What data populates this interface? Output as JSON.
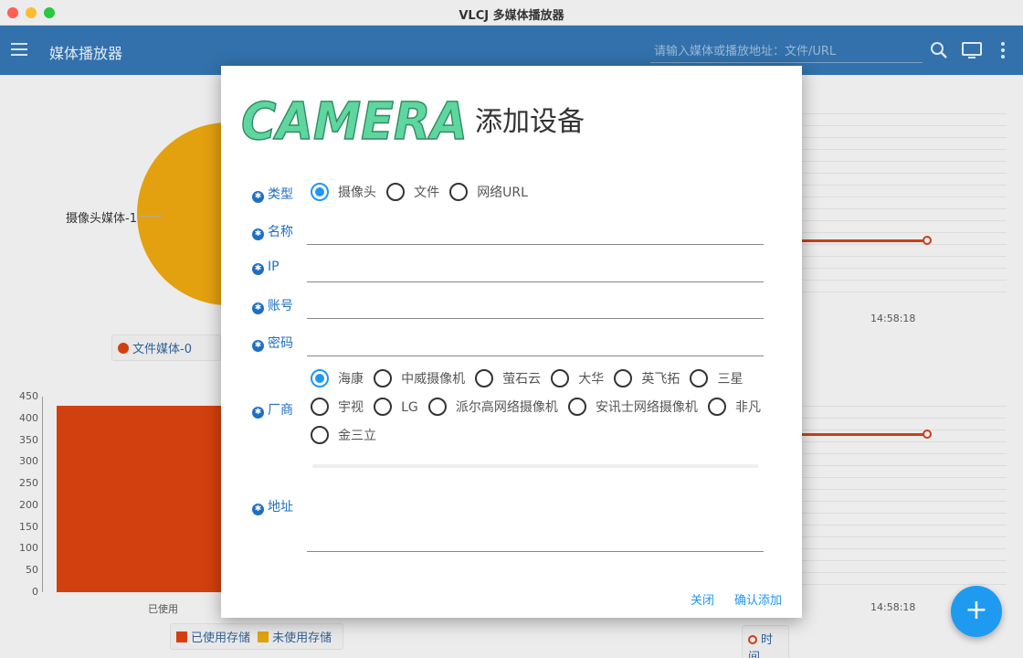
{
  "window": {
    "title": "VLCJ 多媒体播放器"
  },
  "header": {
    "title": "媒体播放器",
    "search_placeholder": "请输入媒体或播放地址：文件/URL",
    "icons": [
      "menu-icon",
      "search-icon",
      "tv-icon",
      "more-vert-icon"
    ]
  },
  "background": {
    "pie_label": "摄像头媒体-1",
    "pie_legend": [
      "文件媒体-0"
    ],
    "bar_yticks": [
      "450",
      "400",
      "350",
      "300",
      "250",
      "200",
      "150",
      "100",
      "50",
      "0"
    ],
    "bar_xlabel": "已使用",
    "bar_legend": [
      "已使用存储",
      "未使用存储"
    ],
    "line_xtick_1": "14:58:18",
    "line_xtick_2": "14:58:18",
    "line_legend": "时间",
    "colors": {
      "orange_red": "#d3400f",
      "amber": "#e3a10f",
      "line": "#c9401a"
    }
  },
  "dialog": {
    "logo_text": "CAMERA",
    "title": "添加设备",
    "fields": {
      "type": {
        "label": "类型",
        "options": [
          "摄像头",
          "文件",
          "网络URL"
        ],
        "selected": "摄像头"
      },
      "name": {
        "label": "名称",
        "value": ""
      },
      "ip": {
        "label": "IP",
        "value": ""
      },
      "account": {
        "label": "账号",
        "value": ""
      },
      "password": {
        "label": "密码",
        "value": ""
      },
      "vendor": {
        "label": "厂商",
        "row1": [
          "海康",
          "中威摄像机",
          "萤石云",
          "大华",
          "英飞拓",
          "三星"
        ],
        "row2": [
          "宇视",
          "LG",
          "派尔高网络摄像机",
          "安讯士网络摄像机",
          "非凡"
        ],
        "row3": [
          "金三立"
        ],
        "selected": "海康"
      },
      "address": {
        "label": "地址",
        "value": ""
      }
    },
    "buttons": {
      "close": "关闭",
      "confirm": "确认添加"
    },
    "accent": "#2196f3",
    "label_color": "#1f6fc1"
  },
  "fab": {
    "label": "+"
  }
}
